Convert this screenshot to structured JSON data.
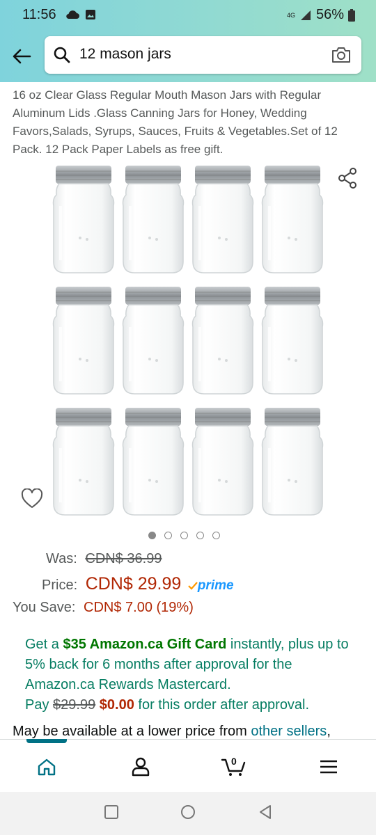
{
  "status": {
    "time": "11:56",
    "network": "4G",
    "battery": "56%"
  },
  "search": {
    "query": "12 mason jars"
  },
  "product": {
    "title": "16 oz Clear Glass Regular Mouth Mason Jars with Regular Aluminum Lids .Glass Canning Jars for Honey, Wedding Favors,Salads, Syrups, Sauces, Fruits & Vegetables.Set of 12 Pack. 12 Pack Paper Labels as free gift.",
    "image_count": 5,
    "active_image": 1
  },
  "pricing": {
    "was_label": "Was:",
    "was_value": "CDN$ 36.99",
    "price_label": "Price:",
    "price_value": "CDN$ 29.99",
    "prime": "prime",
    "save_label": "You Save:",
    "save_value": "CDN$ 7.00 (19%)"
  },
  "promo": {
    "part1": "Get a ",
    "gift": "$35 Amazon.ca Gift Card",
    "part2": " instantly, plus up to 5% back for 6 months after approval for the Amazon.ca Rewards Mastercard.",
    "pay": "Pay ",
    "old_price": "$29.99",
    "new_price": "$0.00",
    "part3": " for this order after approval."
  },
  "availability": {
    "text": "May be available at a lower price from ",
    "link": "other sellers",
    "tail": ","
  },
  "nav": {
    "cart_count": "0"
  },
  "colors": {
    "accent": "#007185",
    "price": "#b12704",
    "promo": "#067d62"
  }
}
